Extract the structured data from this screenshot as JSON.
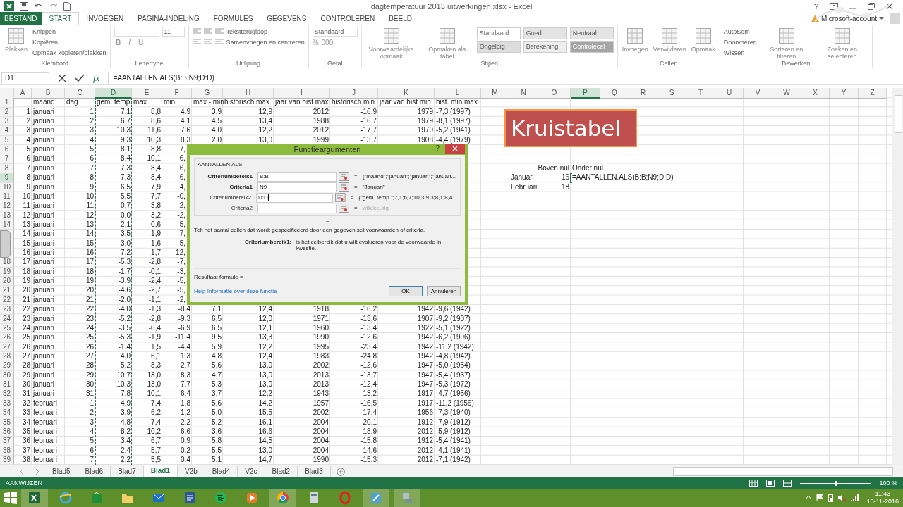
{
  "window": {
    "title": "dagtemperatuur 2013 uitwerkingen.xlsx - Excel",
    "help": "?"
  },
  "tabs": [
    {
      "label": "BESTAND",
      "kind": "file",
      "selected": false
    },
    {
      "label": "START",
      "kind": "tab",
      "selected": true
    },
    {
      "label": "INVOEGEN",
      "kind": "tab",
      "selected": false
    },
    {
      "label": "PAGINA-INDELING",
      "kind": "tab",
      "selected": false
    },
    {
      "label": "FORMULES",
      "kind": "tab",
      "selected": false
    },
    {
      "label": "GEGEVENS",
      "kind": "tab",
      "selected": false
    },
    {
      "label": "CONTROLEREN",
      "kind": "tab",
      "selected": false
    },
    {
      "label": "BEELD",
      "kind": "tab",
      "selected": false
    }
  ],
  "account": "Microsoft-account",
  "ribbon": [
    {
      "label": "Klembord",
      "parts": [
        {
          "kind": "large",
          "label": "Plakken"
        },
        {
          "kind": "stack",
          "rows": [
            [
              {
                "kind": "small",
                "label": "Knippen"
              }
            ],
            [
              {
                "kind": "small",
                "label": "Kopiëren"
              }
            ],
            [
              {
                "kind": "small",
                "label": "Opmaak kopiëren/plakken"
              }
            ]
          ]
        }
      ]
    },
    {
      "label": "Lettertype",
      "parts": [
        {
          "kind": "stack",
          "rows": [
            [
              {
                "kind": "wide-field"
              },
              {
                "kind": "field",
                "value": "11"
              }
            ],
            [
              {
                "kind": "bold-glyph",
                "label": "B"
              },
              {
                "kind": "italic-glyph",
                "label": "I"
              },
              {
                "kind": "underline-glyph",
                "label": "U"
              }
            ]
          ]
        }
      ]
    },
    {
      "label": "Uitlijning",
      "parts": [
        {
          "kind": "stack",
          "rows": [
            [
              {
                "kind": "align"
              },
              {
                "kind": "align"
              },
              {
                "kind": "align"
              },
              {
                "kind": "small",
                "label": "Tekstterugloop"
              }
            ],
            [
              {
                "kind": "align"
              },
              {
                "kind": "align"
              },
              {
                "kind": "align"
              },
              {
                "kind": "small",
                "label": "Samenvoegen en centreren"
              }
            ]
          ]
        }
      ]
    },
    {
      "label": "Getal",
      "parts": [
        {
          "kind": "stack",
          "rows": [
            [
              {
                "kind": "wide-field",
                "value": "Standaard"
              }
            ],
            [
              {
                "kind": "glyph",
                "label": "%"
              },
              {
                "kind": "glyph",
                "label": "000"
              }
            ]
          ]
        }
      ]
    },
    {
      "label": "Stijlen",
      "parts": [
        {
          "kind": "large",
          "label": "Voorwaardelijke opmaak"
        },
        {
          "kind": "large",
          "label": "Opmaken als tabel"
        },
        {
          "kind": "stack",
          "rows": [
            [
              {
                "kind": "style",
                "label": "Standaard",
                "color": "#ffffff"
              },
              {
                "kind": "style",
                "label": "Goed",
                "color": "#e4e4e4"
              },
              {
                "kind": "style",
                "label": "Neutraal",
                "color": "#e4e4e4"
              }
            ],
            [
              {
                "kind": "style",
                "label": "Ongeldig",
                "color": "#dddddd"
              },
              {
                "kind": "style",
                "label": "Berekening",
                "color": "#eeeeee"
              },
              {
                "kind": "style",
                "label": "Controlecel",
                "color": "#a5a5a5"
              }
            ]
          ]
        }
      ]
    },
    {
      "label": "Cellen",
      "parts": [
        {
          "kind": "large",
          "label": "Invoegen"
        },
        {
          "kind": "large",
          "label": "Verwijderen"
        },
        {
          "kind": "large",
          "label": "Opmaak"
        }
      ]
    },
    {
      "label": "Bewerken",
      "parts": [
        {
          "kind": "stack",
          "rows": [
            [
              {
                "kind": "small",
                "label": "AutoSom"
              }
            ],
            [
              {
                "kind": "small",
                "label": "Doorvoeren"
              }
            ],
            [
              {
                "kind": "small",
                "label": "Wissen"
              }
            ]
          ]
        },
        {
          "kind": "large",
          "label": "Sorteren en filteren"
        },
        {
          "kind": "large",
          "label": "Zoeken en selecteren"
        }
      ]
    }
  ],
  "formula_bar": {
    "name_box": "D1",
    "fx": "fx",
    "formula": "=AANTALLEN.ALS(B:B;N9;D:D)"
  },
  "sheet": {
    "columns": [
      {
        "label": "A",
        "selected": false,
        "marquee": false
      },
      {
        "label": "B",
        "selected": false,
        "marquee": false
      },
      {
        "label": "C",
        "selected": false,
        "marquee": false
      },
      {
        "label": "D",
        "selected": true,
        "marquee": true
      },
      {
        "label": "E",
        "selected": false,
        "marquee": false
      },
      {
        "label": "F",
        "selected": false,
        "marquee": false
      },
      {
        "label": "G",
        "selected": false,
        "marquee": false
      },
      {
        "label": "H",
        "selected": false,
        "marquee": false
      },
      {
        "label": "I",
        "selected": false,
        "marquee": false
      },
      {
        "label": "J",
        "selected": false,
        "marquee": false
      },
      {
        "label": "K",
        "selected": false,
        "marquee": false
      },
      {
        "label": "L",
        "selected": false,
        "marquee": false
      },
      {
        "label": "M",
        "selected": false,
        "marquee": false
      },
      {
        "label": "N",
        "selected": false,
        "marquee": false
      },
      {
        "label": "O",
        "selected": false,
        "marquee": false
      },
      {
        "label": "P",
        "selected": true,
        "marquee": false
      },
      {
        "label": "Q",
        "selected": false,
        "marquee": false
      },
      {
        "label": "R",
        "selected": false,
        "marquee": false
      },
      {
        "label": "S",
        "selected": false,
        "marquee": false
      },
      {
        "label": "T",
        "selected": false,
        "marquee": false
      },
      {
        "label": "U",
        "selected": false,
        "marquee": false
      },
      {
        "label": "V",
        "selected": false,
        "marquee": false
      },
      {
        "label": "W",
        "selected": false,
        "marquee": false
      },
      {
        "label": "X",
        "selected": false,
        "marquee": false
      },
      {
        "label": "Y",
        "selected": false,
        "marquee": false
      },
      {
        "label": "Z",
        "selected": false,
        "marquee": false
      }
    ],
    "rows": [
      {
        "number": "1",
        "selected": false,
        "cells": {
          "B": "maand",
          "C": "dag",
          "D": "gem. temp.",
          "E": "max",
          "F": "min",
          "G": "max - min",
          "H": "historisch max",
          "I": "jaar van hist max",
          "J": "historisch min",
          "K": "jaar van hist min",
          "L": "hist. min max"
        }
      },
      {
        "number": "2",
        "selected": false,
        "cells": {
          "A": "1",
          "B": "januari",
          "C": "1",
          "D": "7,1",
          "E": "8,8",
          "F": "4,9",
          "G": "3,9",
          "H": "12,9",
          "I": "2012",
          "J": "-16,9",
          "K": "1979",
          "L": "-7,3 (1997)"
        }
      },
      {
        "number": "3",
        "selected": false,
        "cells": {
          "A": "2",
          "B": "januari",
          "C": "2",
          "D": "6,7",
          "E": "8,6",
          "F": "4,1",
          "G": "4,5",
          "H": "13,4",
          "I": "1988",
          "J": "-16,7",
          "K": "1979",
          "L": "-8,1 (1997)"
        }
      },
      {
        "number": "4",
        "selected": false,
        "cells": {
          "A": "3",
          "B": "januari",
          "C": "3",
          "D": "10,3",
          "E": "11,6",
          "F": "7,6",
          "G": "4,0",
          "H": "12,2",
          "I": "2012",
          "J": "-17,7",
          "K": "1979",
          "L": "-5,2 (1941)"
        }
      },
      {
        "number": "5",
        "selected": false,
        "cells": {
          "A": "4",
          "B": "januari",
          "C": "4",
          "D": "9,3",
          "E": "10,3",
          "F": "8,3",
          "G": "2,0",
          "H": "13,0",
          "I": "1999",
          "J": "-13,7",
          "K": "1908",
          "L": "-4,4 (1979)"
        }
      },
      {
        "number": "6",
        "selected": false,
        "cells": {
          "A": "5",
          "B": "januari",
          "C": "5",
          "D": "8,1",
          "E": "8,8",
          "F": "7,"
        }
      },
      {
        "number": "7",
        "selected": false,
        "cells": {
          "A": "6",
          "B": "januari",
          "C": "6",
          "D": "8,4",
          "E": "10,1",
          "F": "6,"
        }
      },
      {
        "number": "8",
        "selected": false,
        "cells": {
          "A": "7",
          "B": "januari",
          "C": "7",
          "D": "7,3",
          "E": "8,4",
          "F": "6,",
          "O": "Boven nul",
          "P": "Onder nul"
        }
      },
      {
        "number": "9",
        "selected": true,
        "cells": {
          "A": "8",
          "B": "januari",
          "C": "8",
          "D": "7,3",
          "E": "8,4",
          "F": "6,",
          "N": "Januari",
          "O": "16",
          "P": {
            "text": "=AANTALLEN.ALS(B:B;N9;D:D)",
            "active": true
          }
        }
      },
      {
        "number": "10",
        "selected": false,
        "cells": {
          "A": "9",
          "B": "januari",
          "C": "9",
          "D": "6,5",
          "E": "7,9",
          "F": "4,",
          "N": "Februari",
          "O": "18"
        }
      },
      {
        "number": "11",
        "selected": false,
        "cells": {
          "A": "10",
          "B": "januari",
          "C": "10",
          "D": "5,5",
          "E": "7,7",
          "F": "-0,"
        }
      },
      {
        "number": "12",
        "selected": false,
        "cells": {
          "A": "11",
          "B": "januari",
          "C": "11",
          "D": "0,7",
          "E": "3,8",
          "F": "-2,"
        }
      },
      {
        "number": "13",
        "selected": false,
        "cells": {
          "A": "12",
          "B": "januari",
          "C": "12",
          "D": "0,0",
          "E": "3,2",
          "F": "-2,"
        }
      },
      {
        "number": "14",
        "selected": false,
        "cells": {
          "A": "13",
          "B": "januari",
          "C": "13",
          "D": "-2,1",
          "E": "0,6",
          "F": "-5,"
        }
      },
      {
        "selected": false,
        "cells": {
          "A": "14",
          "B": "januari",
          "C": "14",
          "D": "-3,5",
          "E": "-1,9",
          "F": "-7,"
        }
      },
      {
        "selected": false,
        "cells": {
          "A": "15",
          "B": "januari",
          "C": "15",
          "D": "-3,0",
          "E": "-1,6",
          "F": "-5,"
        }
      },
      {
        "selected": false,
        "cells": {
          "A": "16",
          "B": "januari",
          "C": "16",
          "D": "-7,2",
          "E": "-1,7",
          "F": "-12,"
        }
      },
      {
        "number": "18",
        "selected": false,
        "cells": {
          "A": "17",
          "B": "januari",
          "C": "17",
          "D": "-5,3",
          "E": "-2,8",
          "F": "-7,"
        }
      },
      {
        "number": "19",
        "selected": false,
        "cells": {
          "A": "18",
          "B": "januari",
          "C": "18",
          "D": "-1,7",
          "E": "-0,1",
          "F": "-3,"
        }
      },
      {
        "number": "20",
        "selected": false,
        "cells": {
          "A": "19",
          "B": "januari",
          "C": "19",
          "D": "-3,9",
          "E": "-2,4",
          "F": "-5,"
        }
      },
      {
        "number": "21",
        "selected": false,
        "cells": {
          "A": "20",
          "B": "januari",
          "C": "20",
          "D": "-4,6",
          "E": "-2,7",
          "F": "-5,"
        }
      },
      {
        "number": "22",
        "selected": false,
        "cells": {
          "A": "21",
          "B": "januari",
          "C": "21",
          "D": "-2,0",
          "E": "-1,1",
          "F": "-2,"
        }
      },
      {
        "number": "23",
        "selected": false,
        "cells": {
          "A": "22",
          "B": "januari",
          "C": "22",
          "D": "-4,0",
          "E": "-1,3",
          "F": "-8,4",
          "G": "7,1",
          "H": "12,4",
          "I": "1918",
          "J": "-16,2",
          "K": "1942",
          "L": "-9,6 (1942)"
        }
      },
      {
        "number": "24",
        "selected": false,
        "cells": {
          "A": "23",
          "B": "januari",
          "C": "23",
          "D": "-5,2",
          "E": "-2,8",
          "F": "-9,3",
          "G": "6,5",
          "H": "12,0",
          "I": "1971",
          "J": "-13,6",
          "K": "1907",
          "L": "-9,2 (1907)"
        }
      },
      {
        "number": "25",
        "selected": false,
        "cells": {
          "A": "24",
          "B": "januari",
          "C": "24",
          "D": "-3,5",
          "E": "-0,4",
          "F": "-6,9",
          "G": "6,5",
          "H": "12,1",
          "I": "1960",
          "J": "-13,4",
          "K": "1922",
          "L": "-5,1 (1922)"
        }
      },
      {
        "number": "26",
        "selected": false,
        "cells": {
          "A": "25",
          "B": "januari",
          "C": "25",
          "D": "-5,3",
          "E": "-1,9",
          "F": "-11,4",
          "G": "9,5",
          "H": "13,3",
          "I": "1990",
          "J": "-12,6",
          "K": "1942",
          "L": "-6,2 (1996)"
        }
      },
      {
        "number": "27",
        "selected": false,
        "cells": {
          "A": "26",
          "B": "januari",
          "C": "26",
          "D": "-1,4",
          "E": "1,5",
          "F": "-4,4",
          "G": "5,9",
          "H": "12,2",
          "I": "1995",
          "J": "-23,4",
          "K": "1942",
          "L": "-11,2 (1942)"
        }
      },
      {
        "number": "28",
        "selected": false,
        "cells": {
          "A": "27",
          "B": "januari",
          "C": "27",
          "D": "4,0",
          "E": "6,1",
          "F": "1,3",
          "G": "4,8",
          "H": "12,4",
          "I": "1983",
          "J": "-24,8",
          "K": "1942",
          "L": "-4,8 (1942)"
        }
      },
      {
        "number": "29",
        "selected": false,
        "cells": {
          "A": "28",
          "B": "januari",
          "C": "28",
          "D": "5,2",
          "E": "8,3",
          "F": "2,7",
          "G": "5,6",
          "H": "13,0",
          "I": "2002",
          "J": "-12,6",
          "K": "1947",
          "L": "-5,0 (1954)"
        }
      },
      {
        "number": "30",
        "selected": false,
        "cells": {
          "A": "29",
          "B": "januari",
          "C": "29",
          "D": "10,7",
          "E": "13,0",
          "F": "8,3",
          "G": "4,7",
          "H": "13,0",
          "I": "2013",
          "J": "-13,7",
          "K": "1947",
          "L": "-5,4 (1937)"
        }
      },
      {
        "number": "31",
        "selected": false,
        "cells": {
          "A": "30",
          "B": "januari",
          "C": "30",
          "D": "10,3",
          "E": "13,0",
          "F": "7,7",
          "G": "5,3",
          "H": "13,0",
          "I": "2013",
          "J": "-12,4",
          "K": "1947",
          "L": "-5,3 (1972)"
        }
      },
      {
        "number": "32",
        "selected": false,
        "cells": {
          "A": "31",
          "B": "januari",
          "C": "31",
          "D": "7,8",
          "E": "10,1",
          "F": "6,4",
          "G": "3,7",
          "H": "12,2",
          "I": "1943",
          "J": "-13,2",
          "K": "1917",
          "L": "-4,7 (1956)"
        }
      },
      {
        "number": "33",
        "selected": false,
        "cells": {
          "A": "32",
          "B": "februari",
          "C": "1",
          "D": "4,9",
          "E": "7,4",
          "F": "1,8",
          "G": "5,6",
          "H": "14,2",
          "I": "1957",
          "J": "-16,5",
          "K": "1917",
          "L": "-11,2 (1956)"
        }
      },
      {
        "number": "34",
        "selected": false,
        "cells": {
          "A": "33",
          "B": "februari",
          "C": "2",
          "D": "3,9",
          "E": "6,2",
          "F": "1,2",
          "G": "5,0",
          "H": "15,5",
          "I": "2002",
          "J": "-17,4",
          "K": "1956",
          "L": "-7,3 (1940)"
        }
      },
      {
        "number": "35",
        "selected": false,
        "cells": {
          "A": "34",
          "B": "februari",
          "C": "3",
          "D": "4,8",
          "E": "7,4",
          "F": "2,2",
          "G": "5,2",
          "H": "16,1",
          "I": "2004",
          "J": "-20,1",
          "K": "1912",
          "L": "-7,9 (1912)"
        }
      },
      {
        "number": "36",
        "selected": false,
        "cells": {
          "A": "35",
          "B": "februari",
          "C": "4",
          "D": "8,2",
          "E": "10,2",
          "F": "6,6",
          "G": "3,6",
          "H": "16,6",
          "I": "2004",
          "J": "-18,9",
          "K": "2012",
          "L": "-5,9 (1912)"
        }
      },
      {
        "number": "37",
        "selected": false,
        "cells": {
          "A": "36",
          "B": "februari",
          "C": "5",
          "D": "3,4",
          "E": "6,7",
          "F": "0,9",
          "G": "5,8",
          "H": "14,5",
          "I": "2004",
          "J": "-15,8",
          "K": "1912",
          "L": "-5,4 (1941)"
        }
      },
      {
        "number": "38",
        "selected": false,
        "cells": {
          "A": "37",
          "B": "februari",
          "C": "6",
          "D": "2,4",
          "E": "5,7",
          "F": "0,2",
          "G": "5,5",
          "H": "13,0",
          "I": "2004",
          "J": "-14,6",
          "K": "2012",
          "L": "-4,1 (1941)"
        }
      },
      {
        "number": "39",
        "selected": false,
        "cells": {
          "A": "38",
          "B": "februari",
          "C": "7",
          "D": "2,2",
          "E": "5,5",
          "F": "0,4",
          "G": "5,1",
          "H": "14,7",
          "I": "1990",
          "J": "-15,3",
          "K": "2012",
          "L": "-7,1 (1942)"
        }
      }
    ]
  },
  "shape": {
    "text": "Kruistabel"
  },
  "dialog": {
    "title": "Functieargumenten",
    "help": "?",
    "function": "AANTALLEN.ALS",
    "args": [
      {
        "label": "Criteriumbereik1",
        "required": true,
        "value": "B:B",
        "focused": false,
        "result": "{\"maand\";\"januari\";\"januari\";\"januari...",
        "muted": false
      },
      {
        "label": "Criteria1",
        "required": true,
        "value": "N9",
        "focused": false,
        "result": "\"Januari\"",
        "muted": false
      },
      {
        "label": "Criteriumbereik2",
        "required": false,
        "value": "D:D",
        "focused": true,
        "result": "{\"gem. temp.\";7,1;6,7;10,3;9,3;8,1;8,4...",
        "muted": false
      },
      {
        "label": "Criteria2",
        "required": false,
        "focused": false,
        "result": "willekeurig",
        "muted": true
      }
    ],
    "equals": "=",
    "description": "Telt het aantal cellen dat wordt gespecificeerd door een gegeven set voorwaarden of criteria.",
    "param_label": "Criteriumbereik1:",
    "param_text": "is het celbereik dat u wilt evalueren voor de voorwaarde in kwestie.",
    "result_label": "Resultaat formule =",
    "help_link": "Help-informatie over deze functie",
    "buttons": [
      {
        "label": "OK",
        "default": true
      },
      {
        "label": "Annuleren",
        "default": false
      }
    ]
  },
  "sheet_tabs": [
    {
      "label": "Blad5",
      "selected": false
    },
    {
      "label": "Blad6",
      "selected": false
    },
    {
      "label": "Blad7",
      "selected": false
    },
    {
      "label": "Blad1",
      "selected": true
    },
    {
      "label": "V2b",
      "selected": false
    },
    {
      "label": "Blad4",
      "selected": false
    },
    {
      "label": "V2c",
      "selected": false
    },
    {
      "label": "Blad2",
      "selected": false
    },
    {
      "label": "Blad3",
      "selected": false
    }
  ],
  "status_bar": {
    "mode": "AANWIJZEN",
    "zoom": {
      "level": 0.5,
      "reading": "100 %"
    }
  },
  "taskbar": {
    "time": "11:43",
    "date": "13-11-2016"
  }
}
